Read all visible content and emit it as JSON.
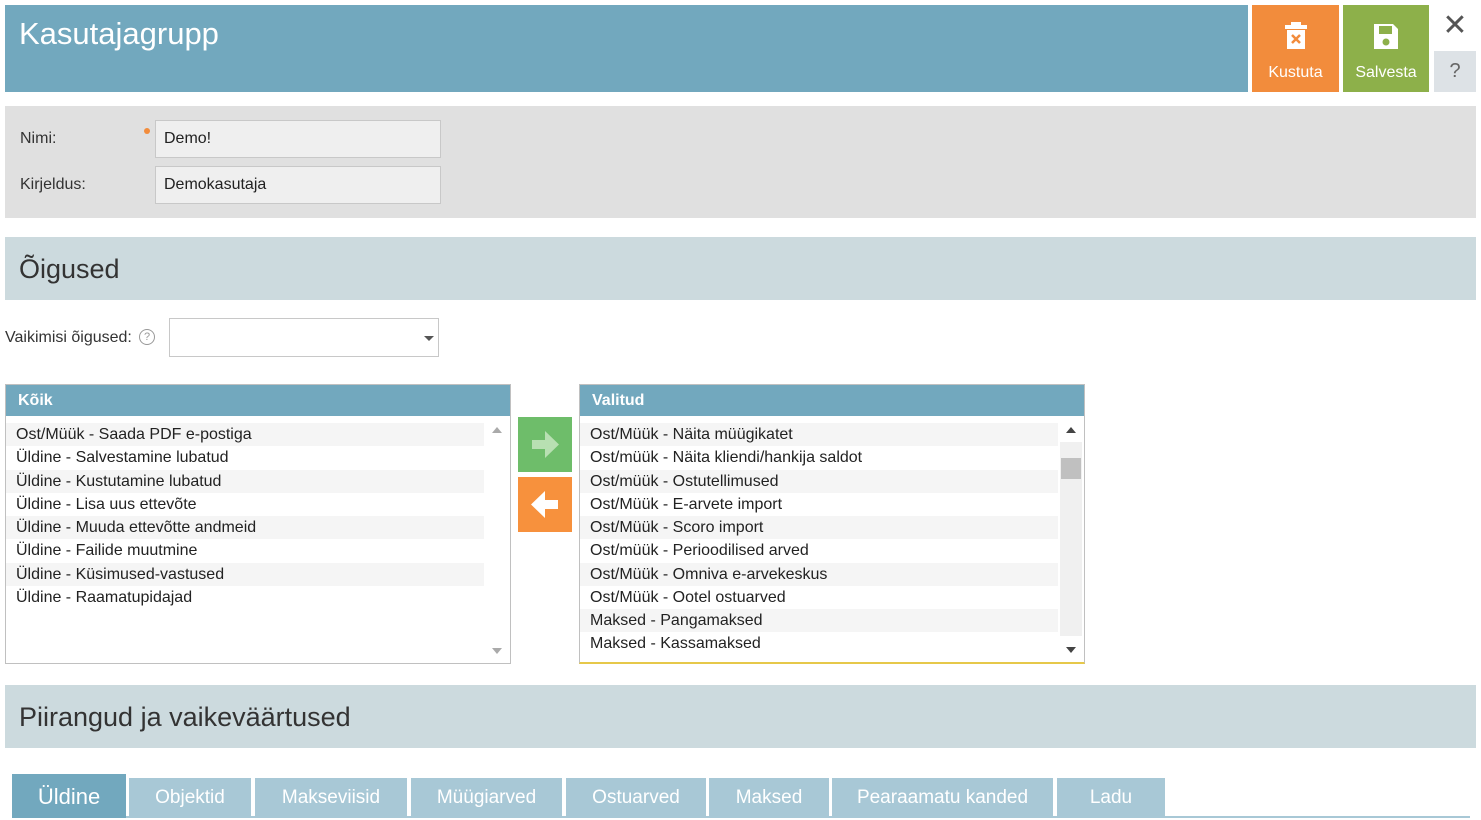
{
  "header": {
    "title": "Kasutajagrupp",
    "delete_label": "Kustuta",
    "save_label": "Salvesta",
    "close_glyph": "✕",
    "help_glyph": "?",
    "colors": {
      "header": "#72a8be",
      "delete": "#f28c3c",
      "save": "#8db04a"
    }
  },
  "form": {
    "name_label": "Nimi:",
    "name_value": "Demo!",
    "description_label": "Kirjeldus:",
    "description_value": "Demokasutaja"
  },
  "rights": {
    "section_title": "Õigused",
    "default_rights_label": "Vaikimisi õigused:",
    "default_rights_value": "",
    "help_glyph": "?",
    "all_list": {
      "header": "Kõik",
      "items": [
        "Ost/Müük - Saada PDF e-postiga",
        "Üldine - Salvestamine lubatud",
        "Üldine - Kustutamine lubatud",
        "Üldine - Lisa uus ettevõte",
        "Üldine - Muuda ettevõtte andmeid",
        "Üldine - Failide muutmine",
        "Üldine - Küsimused-vastused",
        "Üldine - Raamatupidajad"
      ]
    },
    "selected_list": {
      "header": "Valitud",
      "items": [
        "Ost/Müük - Näita müügikatet",
        "Ost/müük - Näita kliendi/hankija saldot",
        "Ost/müük - Ostutellimused",
        "Ost/Müük - E-arvete import",
        "Ost/Müük - Scoro import",
        "Ost/müük - Perioodilised arved",
        "Ost/Müük - Omniva e-arvekeskus",
        "Ost/Müük - Ootel ostuarved",
        "Maksed - Pangamaksed",
        "Maksed - Kassamaksed"
      ]
    },
    "move_right_icon": "arrow-right-icon",
    "move_left_icon": "arrow-left-icon"
  },
  "limits": {
    "section_title": "Piirangud ja vaikeväärtused",
    "tabs": [
      {
        "label": "Üldine",
        "active": true
      },
      {
        "label": "Objektid",
        "active": false
      },
      {
        "label": "Makseviisid",
        "active": false
      },
      {
        "label": "Müügiarved",
        "active": false
      },
      {
        "label": "Ostuarved",
        "active": false
      },
      {
        "label": "Maksed",
        "active": false
      },
      {
        "label": "Pearaamatu kanded",
        "active": false
      },
      {
        "label": "Ladu",
        "active": false
      }
    ]
  }
}
